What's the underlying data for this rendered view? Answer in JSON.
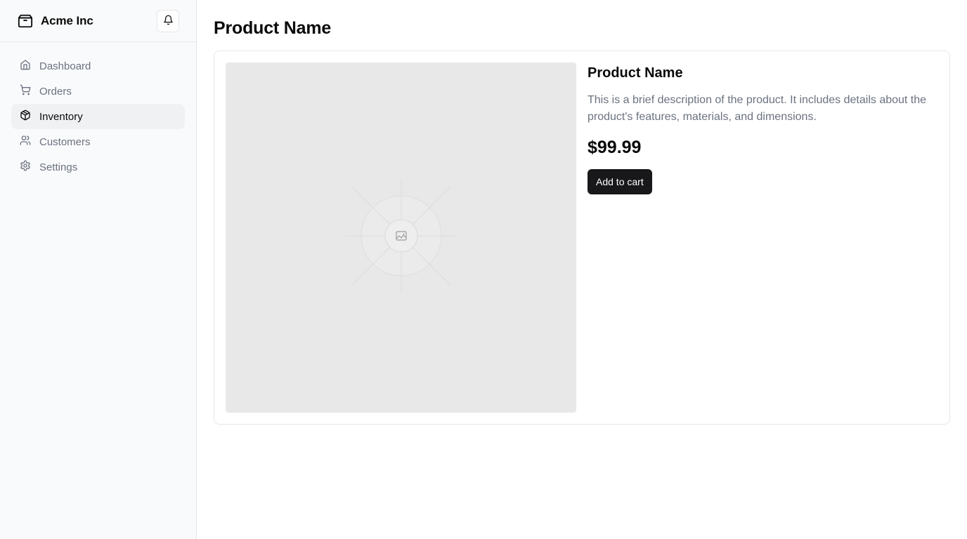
{
  "sidebar": {
    "brand": {
      "name": "Acme Inc",
      "icon": "package-icon"
    },
    "notification_icon": "bell-icon",
    "items": [
      {
        "label": "Dashboard",
        "icon": "home-icon",
        "active": false
      },
      {
        "label": "Orders",
        "icon": "shopping-cart-icon",
        "active": false
      },
      {
        "label": "Inventory",
        "icon": "package-icon",
        "active": true
      },
      {
        "label": "Customers",
        "icon": "users-icon",
        "active": false
      },
      {
        "label": "Settings",
        "icon": "settings-icon",
        "active": false
      }
    ]
  },
  "main": {
    "page_title": "Product Name",
    "product": {
      "image_icon": "image-placeholder-icon",
      "name": "Product Name",
      "description": "This is a brief description of the product. It includes details about the product's features, materials, and dimensions.",
      "price": "$99.99",
      "add_to_cart_label": "Add to cart"
    }
  },
  "colors": {
    "accent": "#18181b",
    "muted_text": "#6b7280",
    "sidebar_bg": "#f9fafb",
    "active_nav_bg": "#f0f1f3",
    "border": "#e5e7eb",
    "image_placeholder_bg": "#e8e8e8"
  }
}
